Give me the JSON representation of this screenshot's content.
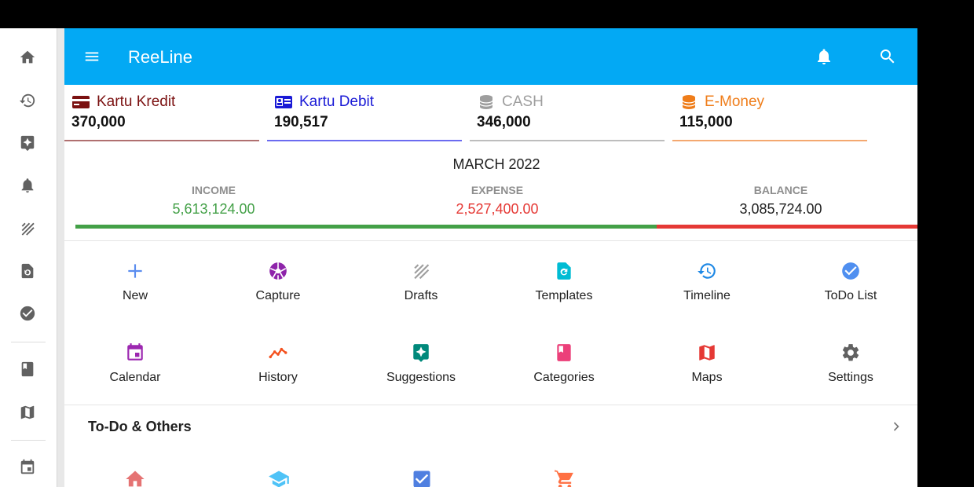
{
  "app": {
    "title": "ReeLine"
  },
  "colors": {
    "appbar": "#03a9f4",
    "income": "#43a047",
    "expense": "#e53935",
    "kredit": "#7b1111",
    "debit": "#1a1ad6",
    "cash": "#9e9e9e",
    "emoney": "#ef7d1a"
  },
  "rail": {
    "items": [
      {
        "icon": "home-icon"
      },
      {
        "icon": "history-icon"
      },
      {
        "icon": "suggestions-icon"
      },
      {
        "icon": "notifications-icon"
      },
      {
        "icon": "drafts-icon"
      },
      {
        "icon": "templates-icon"
      },
      {
        "icon": "todo-check-icon"
      },
      {
        "icon": "categories-book-icon"
      },
      {
        "icon": "maps-icon"
      },
      {
        "icon": "calendar-icon"
      }
    ]
  },
  "accounts": [
    {
      "name": "Kartu Kredit",
      "amount": "370,000",
      "icon": "credit-card-icon"
    },
    {
      "name": "Kartu Debit",
      "amount": "190,517",
      "icon": "debit-card-icon"
    },
    {
      "name": "CASH",
      "amount": "346,000",
      "icon": "cash-stack-icon"
    },
    {
      "name": "E-Money",
      "amount": "115,000",
      "icon": "coins-icon"
    }
  ],
  "summary": {
    "month": "MARCH 2022",
    "income_label": "INCOME",
    "income_value": "5,613,124.00",
    "expense_label": "EXPENSE",
    "expense_value": "2,527,400.00",
    "balance_label": "BALANCE",
    "balance_value": "3,085,724.00",
    "income_share": 0.69
  },
  "menu": {
    "row1": [
      {
        "label": "New",
        "icon": "plus-icon"
      },
      {
        "label": "Capture",
        "icon": "camera-aperture-icon"
      },
      {
        "label": "Drafts",
        "icon": "drafts-icon"
      },
      {
        "label": "Templates",
        "icon": "templates-icon"
      },
      {
        "label": "Timeline",
        "icon": "history-icon"
      },
      {
        "label": "ToDo List",
        "icon": "check-circle-icon"
      }
    ],
    "row2": [
      {
        "label": "Calendar",
        "icon": "calendar-icon"
      },
      {
        "label": "History",
        "icon": "trend-line-icon"
      },
      {
        "label": "Suggestions",
        "icon": "suggestions-icon"
      },
      {
        "label": "Categories",
        "icon": "book-icon"
      },
      {
        "label": "Maps",
        "icon": "map-icon"
      },
      {
        "label": "Settings",
        "icon": "gear-icon"
      }
    ]
  },
  "todo": {
    "title": "To-Do & Others"
  },
  "bottom_icons": [
    "house-icon",
    "graduation-cap-icon",
    "checkbox-icon",
    "cart-icon"
  ]
}
